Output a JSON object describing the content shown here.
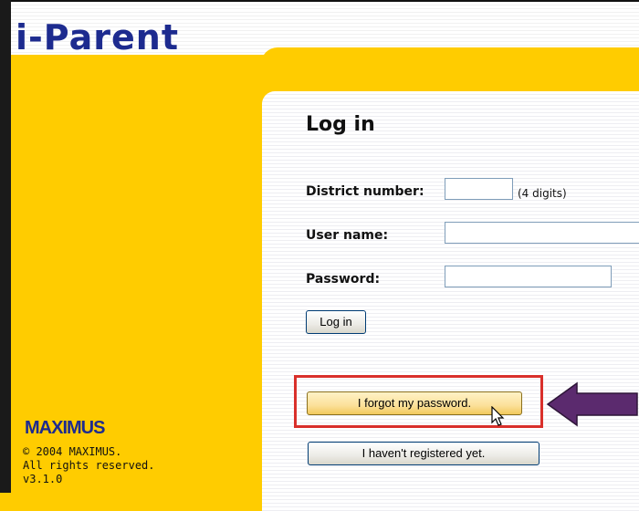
{
  "app": {
    "logo": "i-Parent"
  },
  "login": {
    "title": "Log in",
    "district_label": "District number:",
    "district_hint": "(4 digits)",
    "district_value": "",
    "username_label": "User name:",
    "username_value": "",
    "password_label": "Password:",
    "password_value": "",
    "login_button": "Log in"
  },
  "actions": {
    "forgot_password": "I forgot my password.",
    "not_registered": "I haven't registered yet."
  },
  "footer": {
    "brand": "MAXIMUS",
    "copyright": "© 2004 MAXIMUS.",
    "rights": "All rights reserved.",
    "version": "v3.1.0"
  },
  "colors": {
    "background": "#ffcc00",
    "logo": "#1d2b8f",
    "highlight_box": "#d9302b",
    "arrow": "#5b2a6e"
  },
  "icons": [
    "left-arrow-icon",
    "mouse-cursor-icon"
  ]
}
